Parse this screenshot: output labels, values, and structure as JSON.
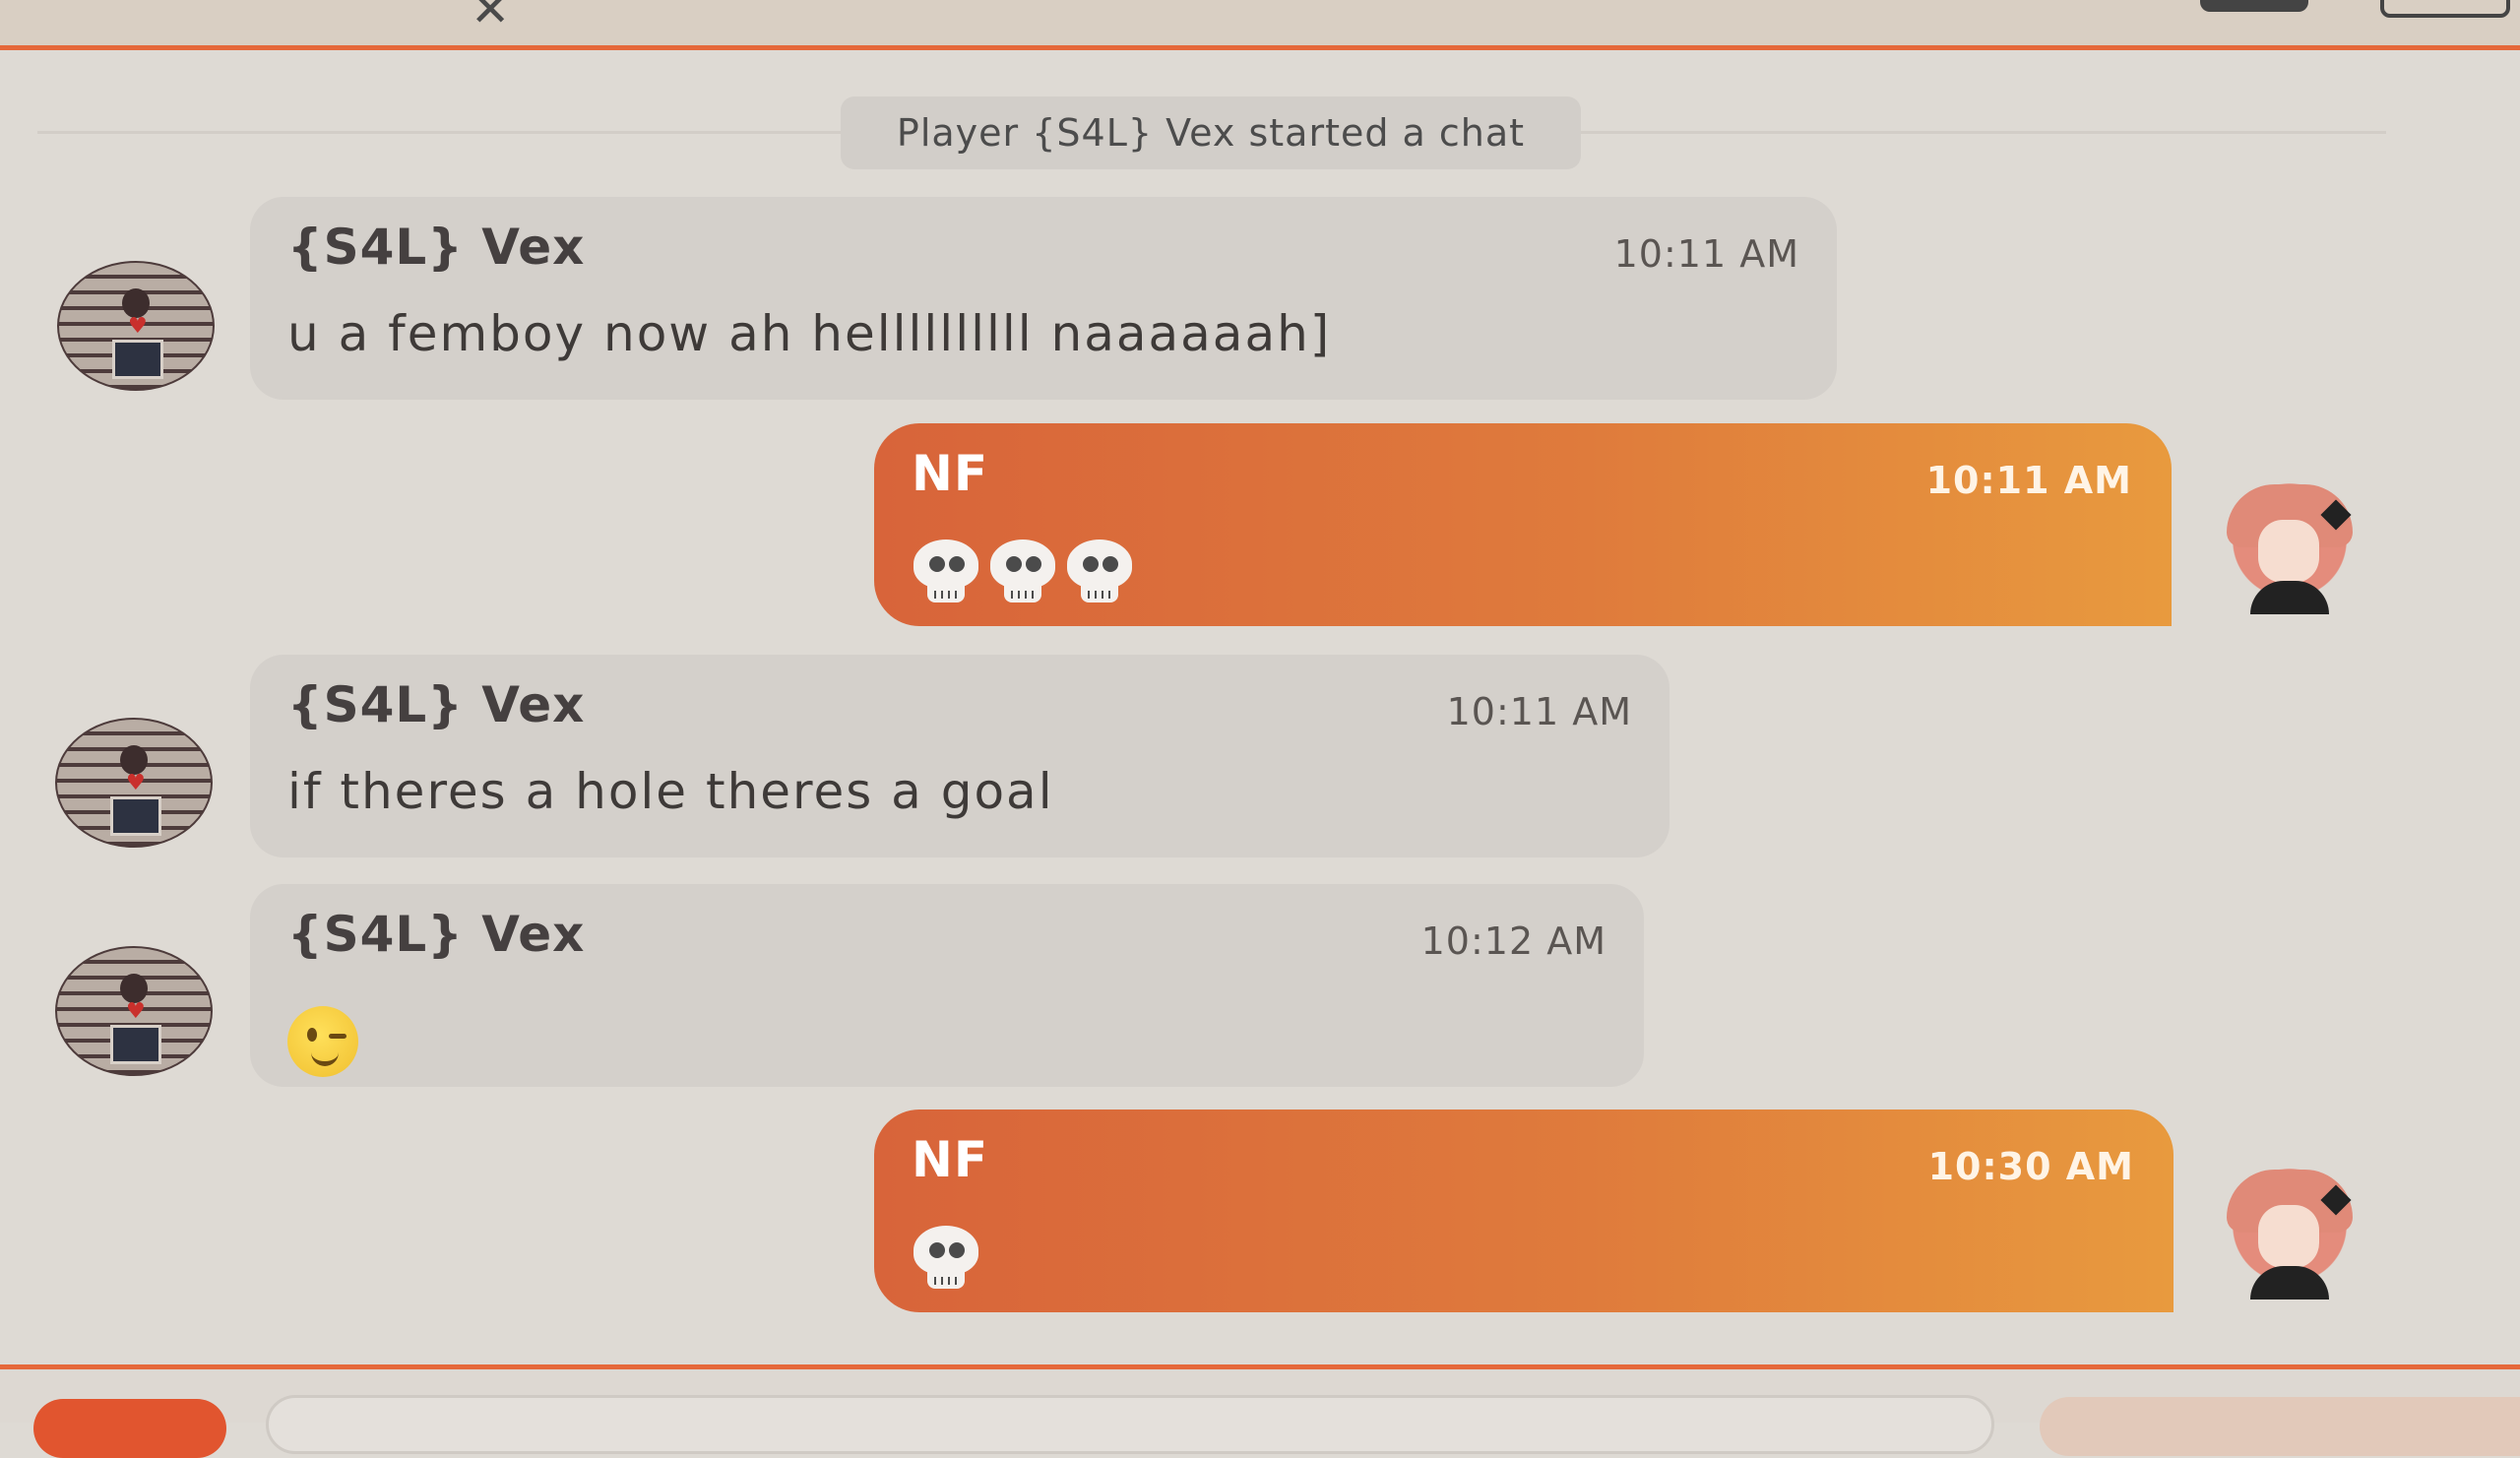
{
  "theme": {
    "accent": "#e5683a",
    "outgoing_bubble": "#dd7039",
    "incoming_bubble": "#d4d0cb"
  },
  "chat": {
    "system_notice": "Player {S4L} Vex started a chat",
    "messages": [
      {
        "direction": "incoming",
        "sender": "{S4L} Vex",
        "time": "10:11 AM",
        "text": "u a femboy now ah hellllllllll naaaaaah]"
      },
      {
        "direction": "outgoing",
        "sender": "NF",
        "time": "10:11 AM",
        "emoji": [
          "skull",
          "skull",
          "skull"
        ]
      },
      {
        "direction": "incoming",
        "sender": "{S4L} Vex",
        "time": "10:11 AM",
        "text": "if theres a hole theres a goal"
      },
      {
        "direction": "incoming",
        "sender": "{S4L} Vex",
        "time": "10:12 AM",
        "emoji": [
          "winking-face"
        ]
      },
      {
        "direction": "outgoing",
        "sender": "NF",
        "time": "10:30 AM",
        "emoji": [
          "skull"
        ]
      }
    ]
  }
}
